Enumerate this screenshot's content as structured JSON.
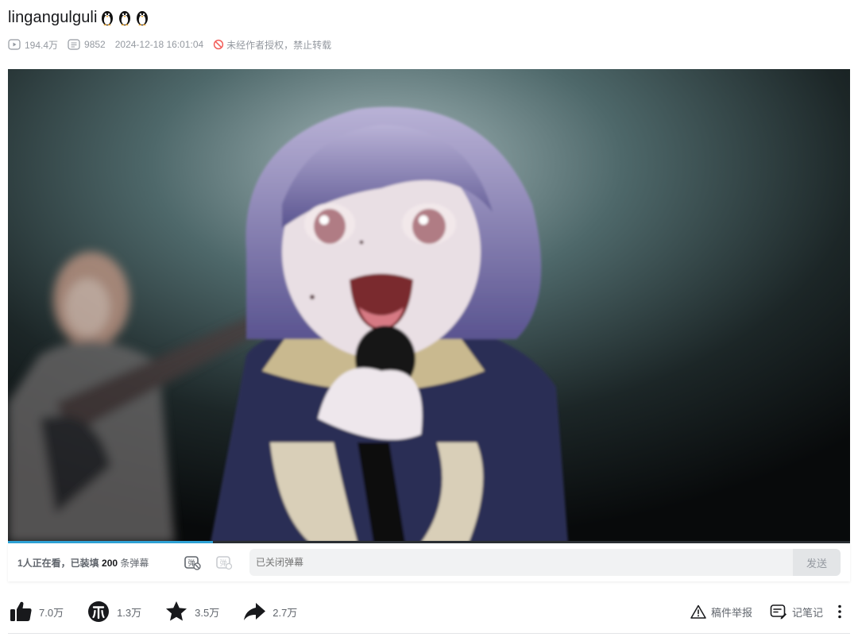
{
  "video": {
    "title": "lingangulguli",
    "views": "194.4万",
    "danmaku_count": "9852",
    "date": "2024-12-18 16:01:04",
    "copyright": "未经作者授权，禁止转载"
  },
  "player": {
    "progress_percent": 24.3
  },
  "danmaku": {
    "watching_prefix": "1人正在看，已装填",
    "loaded_count": "200",
    "loaded_suffix": "条弹幕",
    "input_placeholder": "已关闭弹幕",
    "send_label": "发送"
  },
  "toolbar": {
    "like": "7.0万",
    "coin": "1.3万",
    "favorite": "3.5万",
    "share": "2.7万",
    "report": "稿件举报",
    "notes": "记笔记"
  },
  "colors": {
    "accent": "#2fa3d6",
    "icon_dark": "#18191c",
    "text_muted": "#9499a0",
    "warn_red": "#f25d59"
  }
}
